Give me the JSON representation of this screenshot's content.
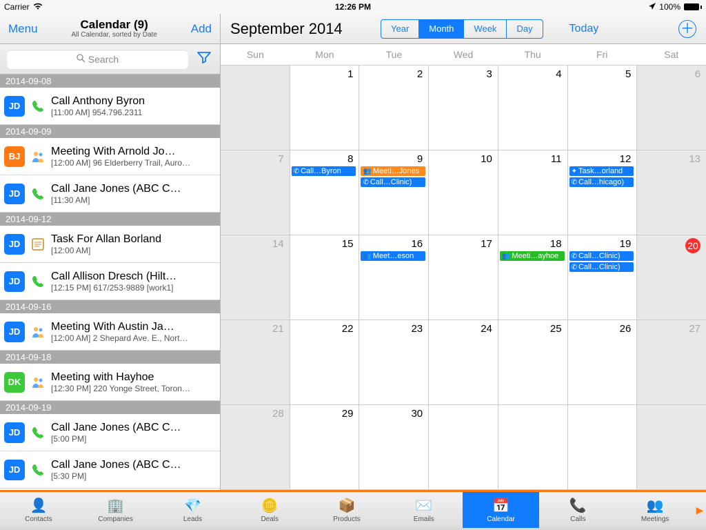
{
  "status": {
    "carrier": "Carrier",
    "time": "12:26 PM",
    "battery": "100%"
  },
  "sidebar": {
    "menu": "Menu",
    "title": "Calendar (9)",
    "subtitle": "All Calendar, sorted by Date",
    "add": "Add",
    "search_placeholder": "Search"
  },
  "groups": [
    {
      "date": "2014-09-08",
      "items": [
        {
          "badge": "JD",
          "badgeColor": "blue",
          "type": "call",
          "title": "Call Anthony Byron",
          "sub": "[11:00 AM] 954.796.2311"
        }
      ]
    },
    {
      "date": "2014-09-09",
      "items": [
        {
          "badge": "BJ",
          "badgeColor": "orange",
          "type": "meeting",
          "title": "Meeting With Arnold Jo…",
          "sub": "[12:00 AM] 96 Elderberry Trail, Auro…"
        },
        {
          "badge": "JD",
          "badgeColor": "blue",
          "type": "call",
          "title": "Call Jane Jones (ABC C…",
          "sub": "[11:30 AM]"
        }
      ]
    },
    {
      "date": "2014-09-12",
      "items": [
        {
          "badge": "JD",
          "badgeColor": "blue",
          "type": "task",
          "title": "Task For Allan Borland",
          "sub": "[12:00 AM]"
        },
        {
          "badge": "JD",
          "badgeColor": "blue",
          "type": "call",
          "title": "Call Allison Dresch (Hilt…",
          "sub": "[12:15 PM] 617/253-9889 [work1]"
        }
      ]
    },
    {
      "date": "2014-09-16",
      "items": [
        {
          "badge": "JD",
          "badgeColor": "blue",
          "type": "meeting",
          "title": "Meeting With Austin  Ja…",
          "sub": "[12:00 AM] 2 Shepard Ave. E., Nort…"
        }
      ]
    },
    {
      "date": "2014-09-18",
      "items": [
        {
          "badge": "DK",
          "badgeColor": "green",
          "type": "meeting",
          "title": "Meeting with Hayhoe",
          "sub": "[12:30 PM] 220 Yonge Street, Toron…"
        }
      ]
    },
    {
      "date": "2014-09-19",
      "items": [
        {
          "badge": "JD",
          "badgeColor": "blue",
          "type": "call",
          "title": "Call Jane Jones (ABC C…",
          "sub": "[5:00 PM]"
        },
        {
          "badge": "JD",
          "badgeColor": "blue",
          "type": "call",
          "title": "Call Jane Jones (ABC C…",
          "sub": "[5:30 PM]"
        }
      ]
    }
  ],
  "calendar": {
    "title": "September 2014",
    "views": [
      "Year",
      "Month",
      "Week",
      "Day"
    ],
    "active_view": "Month",
    "today": "Today",
    "dow": [
      "Sun",
      "Mon",
      "Tue",
      "Wed",
      "Thu",
      "Fri",
      "Sat"
    ],
    "today_date": 20,
    "weeks": [
      [
        {
          "n": "",
          "wknd": true
        },
        {
          "n": 1
        },
        {
          "n": 2
        },
        {
          "n": 3
        },
        {
          "n": 4
        },
        {
          "n": 5
        },
        {
          "n": 6,
          "wknd": true
        }
      ],
      [
        {
          "n": 7,
          "wknd": true
        },
        {
          "n": 8,
          "events": [
            {
              "c": "blue",
              "t": "call",
              "l": "Call…Byron"
            }
          ]
        },
        {
          "n": 9,
          "events": [
            {
              "c": "orange",
              "t": "meeting",
              "l": "Meeti…Jones"
            },
            {
              "c": "blue",
              "t": "call",
              "l": "Call…Clinic)"
            }
          ]
        },
        {
          "n": 10
        },
        {
          "n": 11
        },
        {
          "n": 12,
          "events": [
            {
              "c": "blue",
              "t": "task",
              "l": "Task…orland"
            },
            {
              "c": "blue",
              "t": "call",
              "l": "Call…hicago)"
            }
          ]
        },
        {
          "n": 13,
          "wknd": true
        }
      ],
      [
        {
          "n": 14,
          "wknd": true
        },
        {
          "n": 15
        },
        {
          "n": 16,
          "events": [
            {
              "c": "blue",
              "t": "meeting",
              "l": "Meet…eson"
            }
          ]
        },
        {
          "n": 17
        },
        {
          "n": 18,
          "events": [
            {
              "c": "green",
              "t": "meeting",
              "l": "Meeti…ayhoe"
            }
          ]
        },
        {
          "n": 19,
          "events": [
            {
              "c": "blue",
              "t": "call",
              "l": "Call…Clinic)"
            },
            {
              "c": "blue",
              "t": "call",
              "l": "Call…Clinic)"
            }
          ]
        },
        {
          "n": 20,
          "wknd": true,
          "today": true
        }
      ],
      [
        {
          "n": 21,
          "wknd": true
        },
        {
          "n": 22
        },
        {
          "n": 23
        },
        {
          "n": 24
        },
        {
          "n": 25
        },
        {
          "n": 26
        },
        {
          "n": 27,
          "wknd": true
        }
      ],
      [
        {
          "n": 28,
          "wknd": true
        },
        {
          "n": 29
        },
        {
          "n": 30
        },
        {
          "n": "",
          "wknd": false
        },
        {
          "n": "",
          "wknd": false
        },
        {
          "n": "",
          "wknd": false
        },
        {
          "n": "",
          "wknd": true
        }
      ]
    ]
  },
  "tabs": [
    "Contacts",
    "Companies",
    "Leads",
    "Deals",
    "Products",
    "Emails",
    "Calendar",
    "Calls",
    "Meetings"
  ],
  "tab_icons": [
    "👤",
    "🏢",
    "💎",
    "🪙",
    "📦",
    "✉️",
    "📅",
    "📞",
    "👥"
  ],
  "active_tab": "Calendar"
}
